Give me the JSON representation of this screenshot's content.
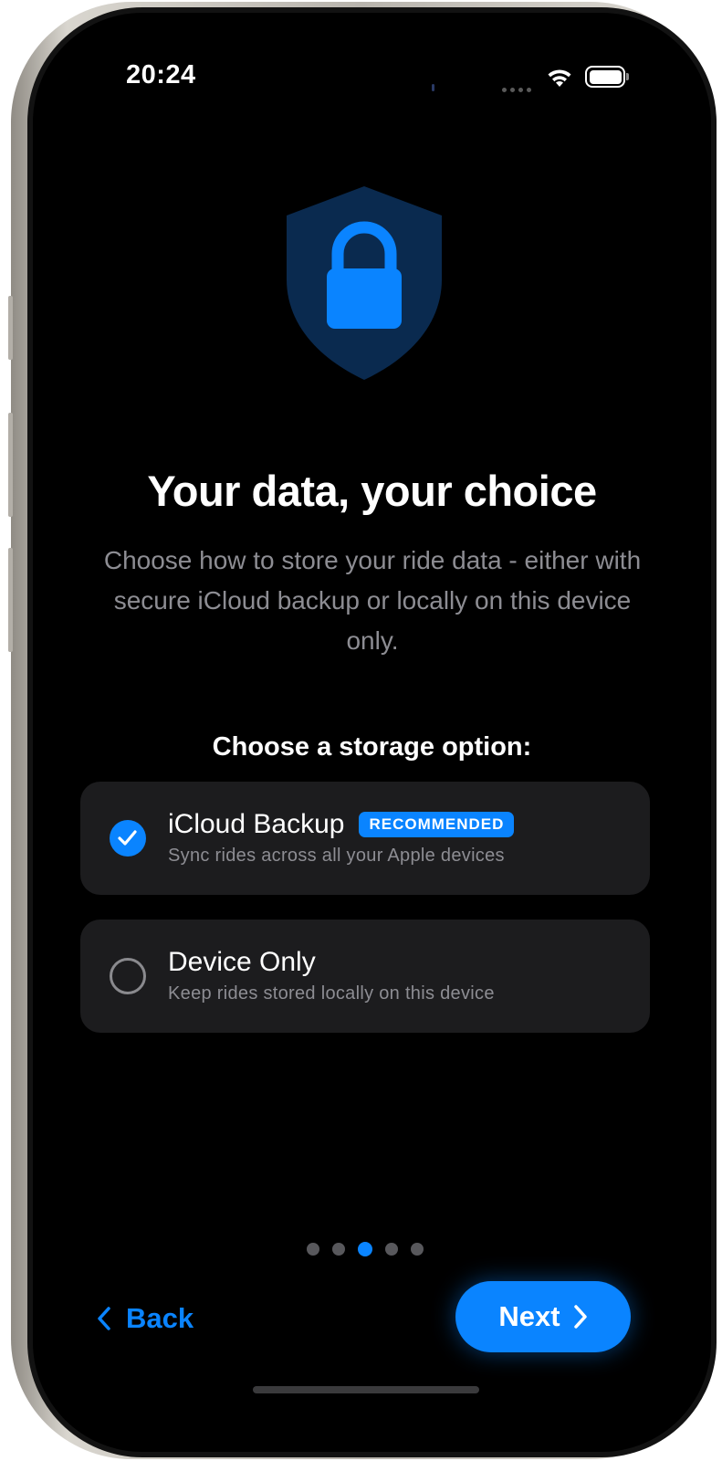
{
  "status_bar": {
    "time": "20:24",
    "wifi_icon": "wifi-icon",
    "battery_icon": "battery-full-icon"
  },
  "hero": {
    "icon": "shield-lock-icon",
    "title": "Your data, your choice",
    "subtitle": "Choose how to store your ride data - either with secure iCloud backup or locally on this device only."
  },
  "storage": {
    "label": "Choose a storage option:",
    "options": [
      {
        "title": "iCloud Backup",
        "badge": "RECOMMENDED",
        "description": "Sync rides across all your Apple devices",
        "selected": true
      },
      {
        "title": "Device Only",
        "description": "Keep rides stored locally on this device",
        "selected": false
      }
    ]
  },
  "pager": {
    "total": 5,
    "current": 3
  },
  "nav": {
    "back_label": "Back",
    "next_label": "Next"
  },
  "colors": {
    "accent": "#0a84ff",
    "card": "#1c1c1e",
    "secondary_text": "#8d8d93",
    "shield": "#0a2a4f"
  }
}
